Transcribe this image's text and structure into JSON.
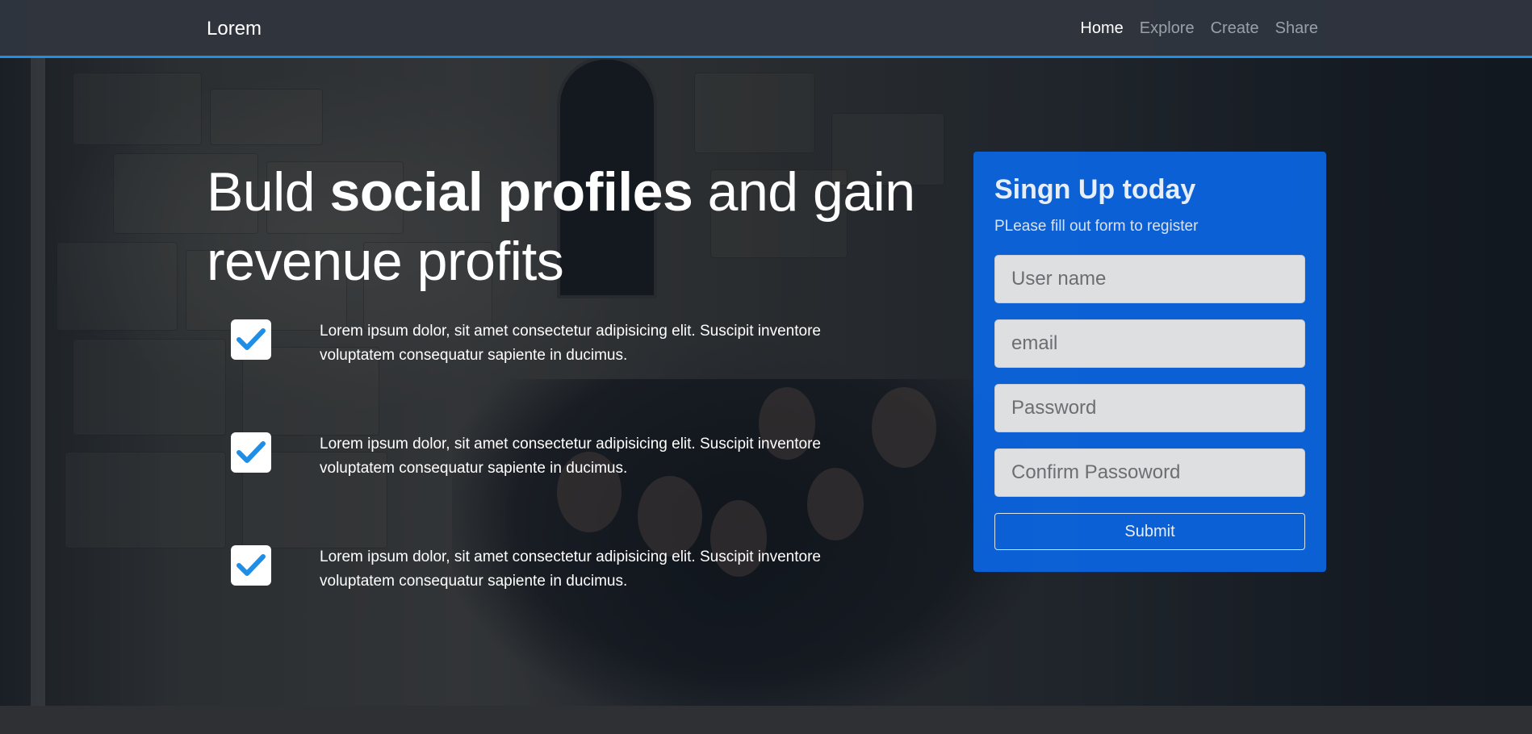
{
  "navbar": {
    "brand": "Lorem",
    "links": [
      {
        "label": "Home",
        "active": true
      },
      {
        "label": "Explore",
        "active": false
      },
      {
        "label": "Create",
        "active": false
      },
      {
        "label": "Share",
        "active": false
      }
    ]
  },
  "hero": {
    "headline_part1": "Buld ",
    "headline_bold": "social profiles",
    "headline_part2": " and gain revenue profits",
    "features": [
      {
        "icon": "check-icon",
        "text": "Lorem ipsum dolor, sit amet consectetur adipisicing elit. Suscipit inventore voluptatem consequatur sapiente in ducimus."
      },
      {
        "icon": "check-icon",
        "text": "Lorem ipsum dolor, sit amet consectetur adipisicing elit. Suscipit inventore voluptatem consequatur sapiente in ducimus."
      },
      {
        "icon": "check-icon",
        "text": "Lorem ipsum dolor, sit amet consectetur adipisicing elit. Suscipit inventore voluptatem consequatur sapiente in ducimus."
      }
    ]
  },
  "signup": {
    "title": "Singn Up today",
    "subtitle": "PLease fill out form to register",
    "fields": {
      "username_placeholder": "User name",
      "email_placeholder": "email",
      "password_placeholder": "Password",
      "confirm_placeholder": "Confirm Passoword"
    },
    "submit_label": "Submit"
  },
  "colors": {
    "accent": "#1f8ee6",
    "card": "#0b66e4",
    "check": "#1f8ee6"
  }
}
